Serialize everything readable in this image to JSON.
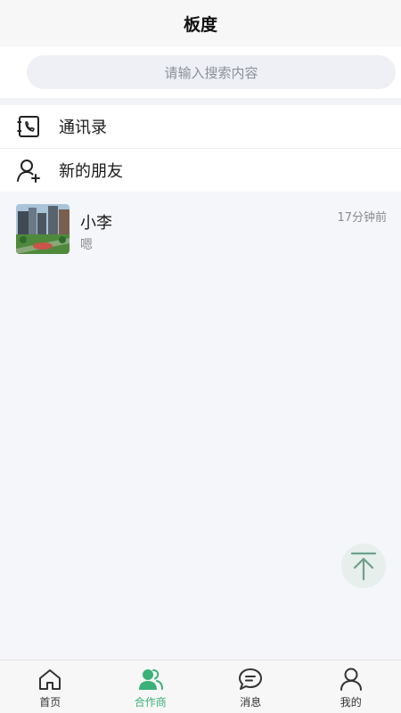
{
  "header": {
    "title": "板度"
  },
  "search": {
    "placeholder": "请输入搜索内容"
  },
  "menu": {
    "items": [
      {
        "label": "通讯录",
        "icon": "contacts-phone-icon"
      },
      {
        "label": "新的朋友",
        "icon": "add-friend-icon"
      }
    ]
  },
  "conversations": [
    {
      "name": "小李",
      "last_message": "嗯",
      "time": "17分钟前",
      "avatar": "city-photo-avatar"
    }
  ],
  "tabbar": {
    "tabs": [
      {
        "label": "首页",
        "icon": "home-icon",
        "active": false
      },
      {
        "label": "合作商",
        "icon": "partners-icon",
        "active": true
      },
      {
        "label": "消息",
        "icon": "message-icon",
        "active": false
      },
      {
        "label": "我的",
        "icon": "user-icon",
        "active": false
      }
    ]
  },
  "colors": {
    "accent": "#3bb17a",
    "background": "#f5f6fa"
  },
  "back_to_top": {
    "icon": "arrow-up-to-top-icon"
  }
}
